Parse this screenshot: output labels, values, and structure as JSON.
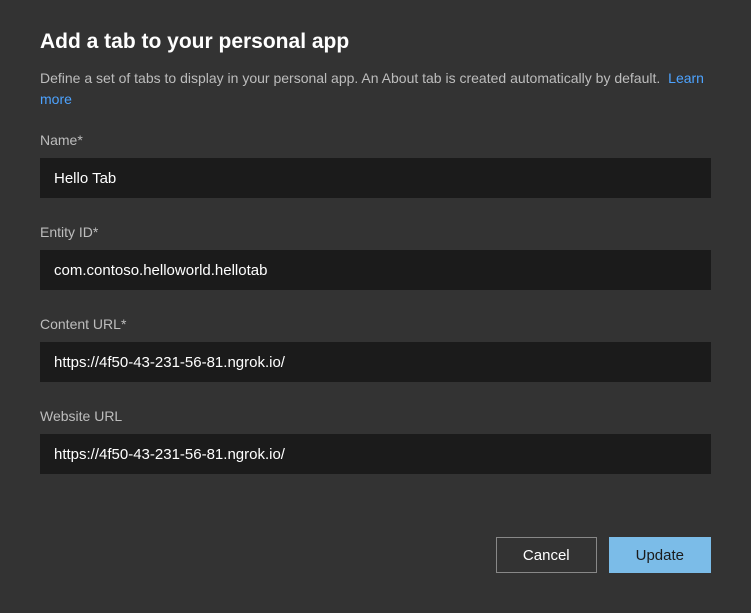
{
  "header": {
    "title": "Add a tab to your personal app",
    "description": "Define a set of tabs to display in your personal app. An About tab is created automatically by default.",
    "learn_more": "Learn more"
  },
  "fields": {
    "name": {
      "label": "Name",
      "required_mark": "*",
      "value": "Hello Tab"
    },
    "entity_id": {
      "label": "Entity ID",
      "required_mark": "*",
      "value": "com.contoso.helloworld.hellotab"
    },
    "content_url": {
      "label": "Content URL",
      "required_mark": "*",
      "value": "https://4f50-43-231-56-81.ngrok.io/"
    },
    "website_url": {
      "label": "Website URL",
      "value": "https://4f50-43-231-56-81.ngrok.io/"
    }
  },
  "buttons": {
    "cancel": "Cancel",
    "update": "Update"
  }
}
